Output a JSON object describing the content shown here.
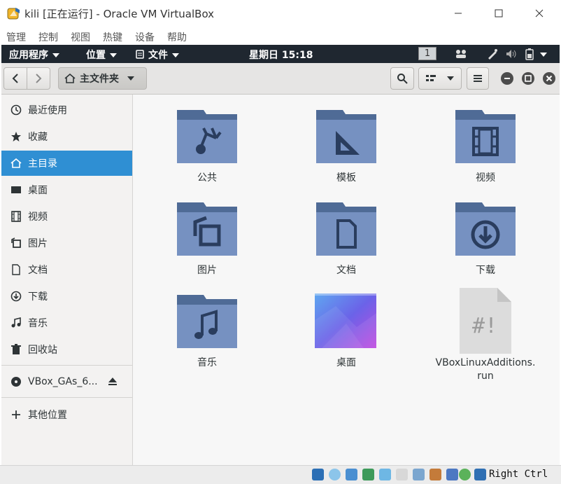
{
  "window": {
    "title": "kili [正在运行] - Oracle VM VirtualBox",
    "menu": [
      "管理",
      "控制",
      "视图",
      "热键",
      "设备",
      "帮助"
    ]
  },
  "guest_panel": {
    "applications": "应用程序",
    "places": "位置",
    "files": "文件",
    "clock": "星期日 15:18",
    "workspace": "1"
  },
  "header": {
    "location": "主文件夹"
  },
  "sidebar": {
    "items": [
      {
        "label": "最近使用",
        "icon": "clock-icon"
      },
      {
        "label": "收藏",
        "icon": "star-icon"
      },
      {
        "label": "主目录",
        "icon": "home-icon"
      },
      {
        "label": "桌面",
        "icon": "desktop-icon"
      },
      {
        "label": "视频",
        "icon": "film-icon"
      },
      {
        "label": "图片",
        "icon": "picture-icon"
      },
      {
        "label": "文档",
        "icon": "document-icon"
      },
      {
        "label": "下载",
        "icon": "download-icon"
      },
      {
        "label": "音乐",
        "icon": "music-icon"
      },
      {
        "label": "回收站",
        "icon": "trash-icon"
      }
    ],
    "device": "VBox_GAs_6...",
    "other_locations": "其他位置"
  },
  "content": {
    "items": [
      {
        "label": "公共"
      },
      {
        "label": "模板"
      },
      {
        "label": "视频"
      },
      {
        "label": "图片"
      },
      {
        "label": "文档"
      },
      {
        "label": "下载"
      },
      {
        "label": "音乐"
      },
      {
        "label": "桌面"
      },
      {
        "label": "VBoxLinuxAdditions.\nrun"
      }
    ]
  },
  "statusbar": {
    "host_key": "Right Ctrl"
  },
  "colors": {
    "selection": "#2f8fd3",
    "folder": "#6f8ab6",
    "panel": "#1f2730"
  }
}
